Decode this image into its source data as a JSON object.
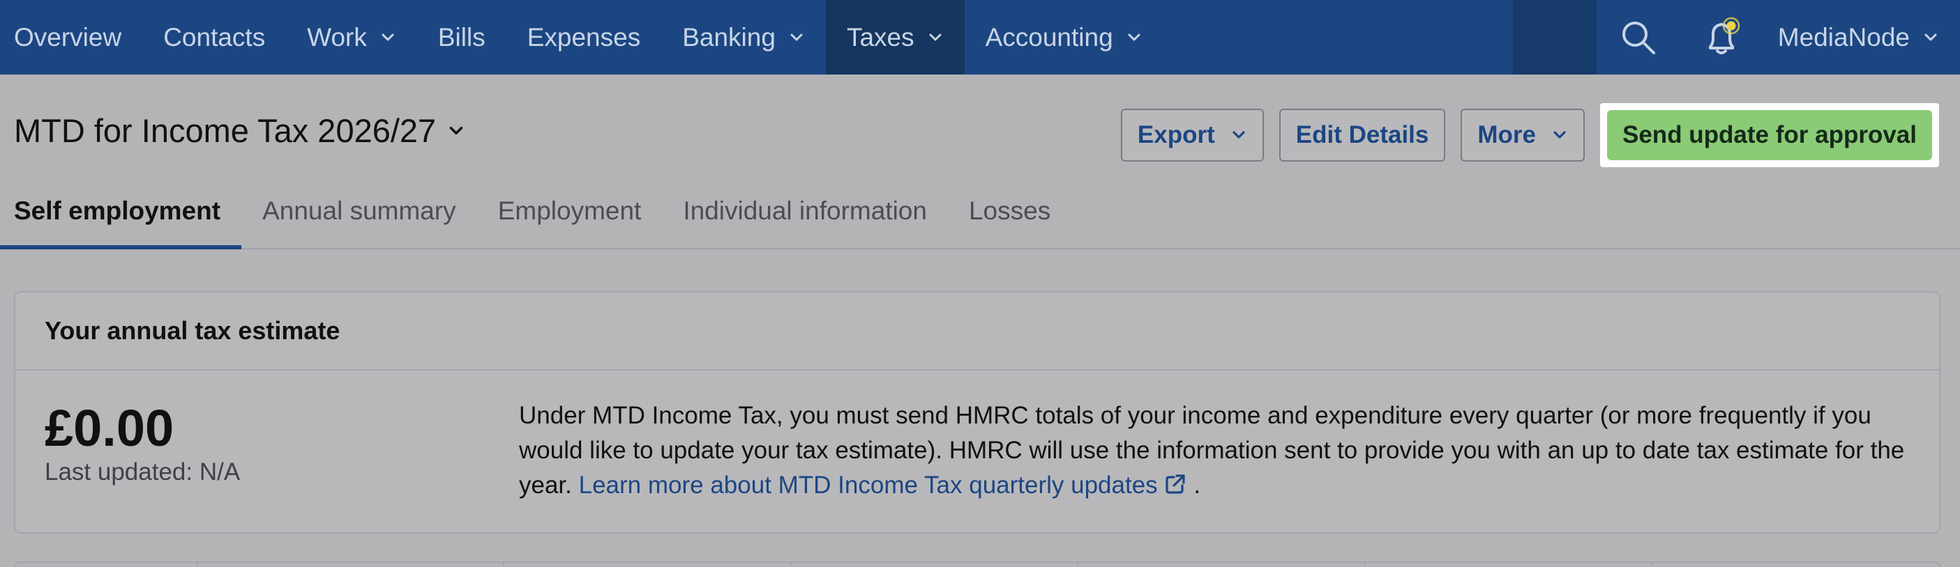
{
  "nav": {
    "items": [
      {
        "label": "Overview",
        "has_dropdown": false,
        "active": false
      },
      {
        "label": "Contacts",
        "has_dropdown": false,
        "active": false
      },
      {
        "label": "Work",
        "has_dropdown": true,
        "active": false
      },
      {
        "label": "Bills",
        "has_dropdown": false,
        "active": false
      },
      {
        "label": "Expenses",
        "has_dropdown": false,
        "active": false
      },
      {
        "label": "Banking",
        "has_dropdown": true,
        "active": false
      },
      {
        "label": "Taxes",
        "has_dropdown": true,
        "active": true
      },
      {
        "label": "Accounting",
        "has_dropdown": true,
        "active": false
      }
    ],
    "org_name": "MediaNode",
    "icons": {
      "search": "search-icon",
      "notifications": "bell-icon"
    },
    "colors": {
      "bar": "#1c4682",
      "active": "#14365f",
      "notification_dot": "#e8d44a"
    }
  },
  "header": {
    "title": "MTD for Income Tax 2026/27",
    "actions": {
      "export": "Export",
      "edit_details": "Edit Details",
      "more": "More",
      "send_update": "Send update for approval"
    },
    "colors": {
      "primary": "#8acb76",
      "link": "#1c4682"
    }
  },
  "tabs": [
    {
      "label": "Self employment",
      "active": true
    },
    {
      "label": "Annual summary",
      "active": false
    },
    {
      "label": "Employment",
      "active": false
    },
    {
      "label": "Individual information",
      "active": false
    },
    {
      "label": "Losses",
      "active": false
    }
  ],
  "estimate": {
    "heading": "Your annual tax estimate",
    "amount": "£0.00",
    "last_updated": "Last updated: N/A",
    "description": "Under MTD Income Tax, you must send HMRC totals of your income and expenditure every quarter (or more frequently if you would like to update your tax estimate). HMRC will use the information sent to provide you with an up to date tax estimate for the year.",
    "link_text": "Learn more about MTD Income Tax quarterly updates",
    "trailing": "."
  }
}
